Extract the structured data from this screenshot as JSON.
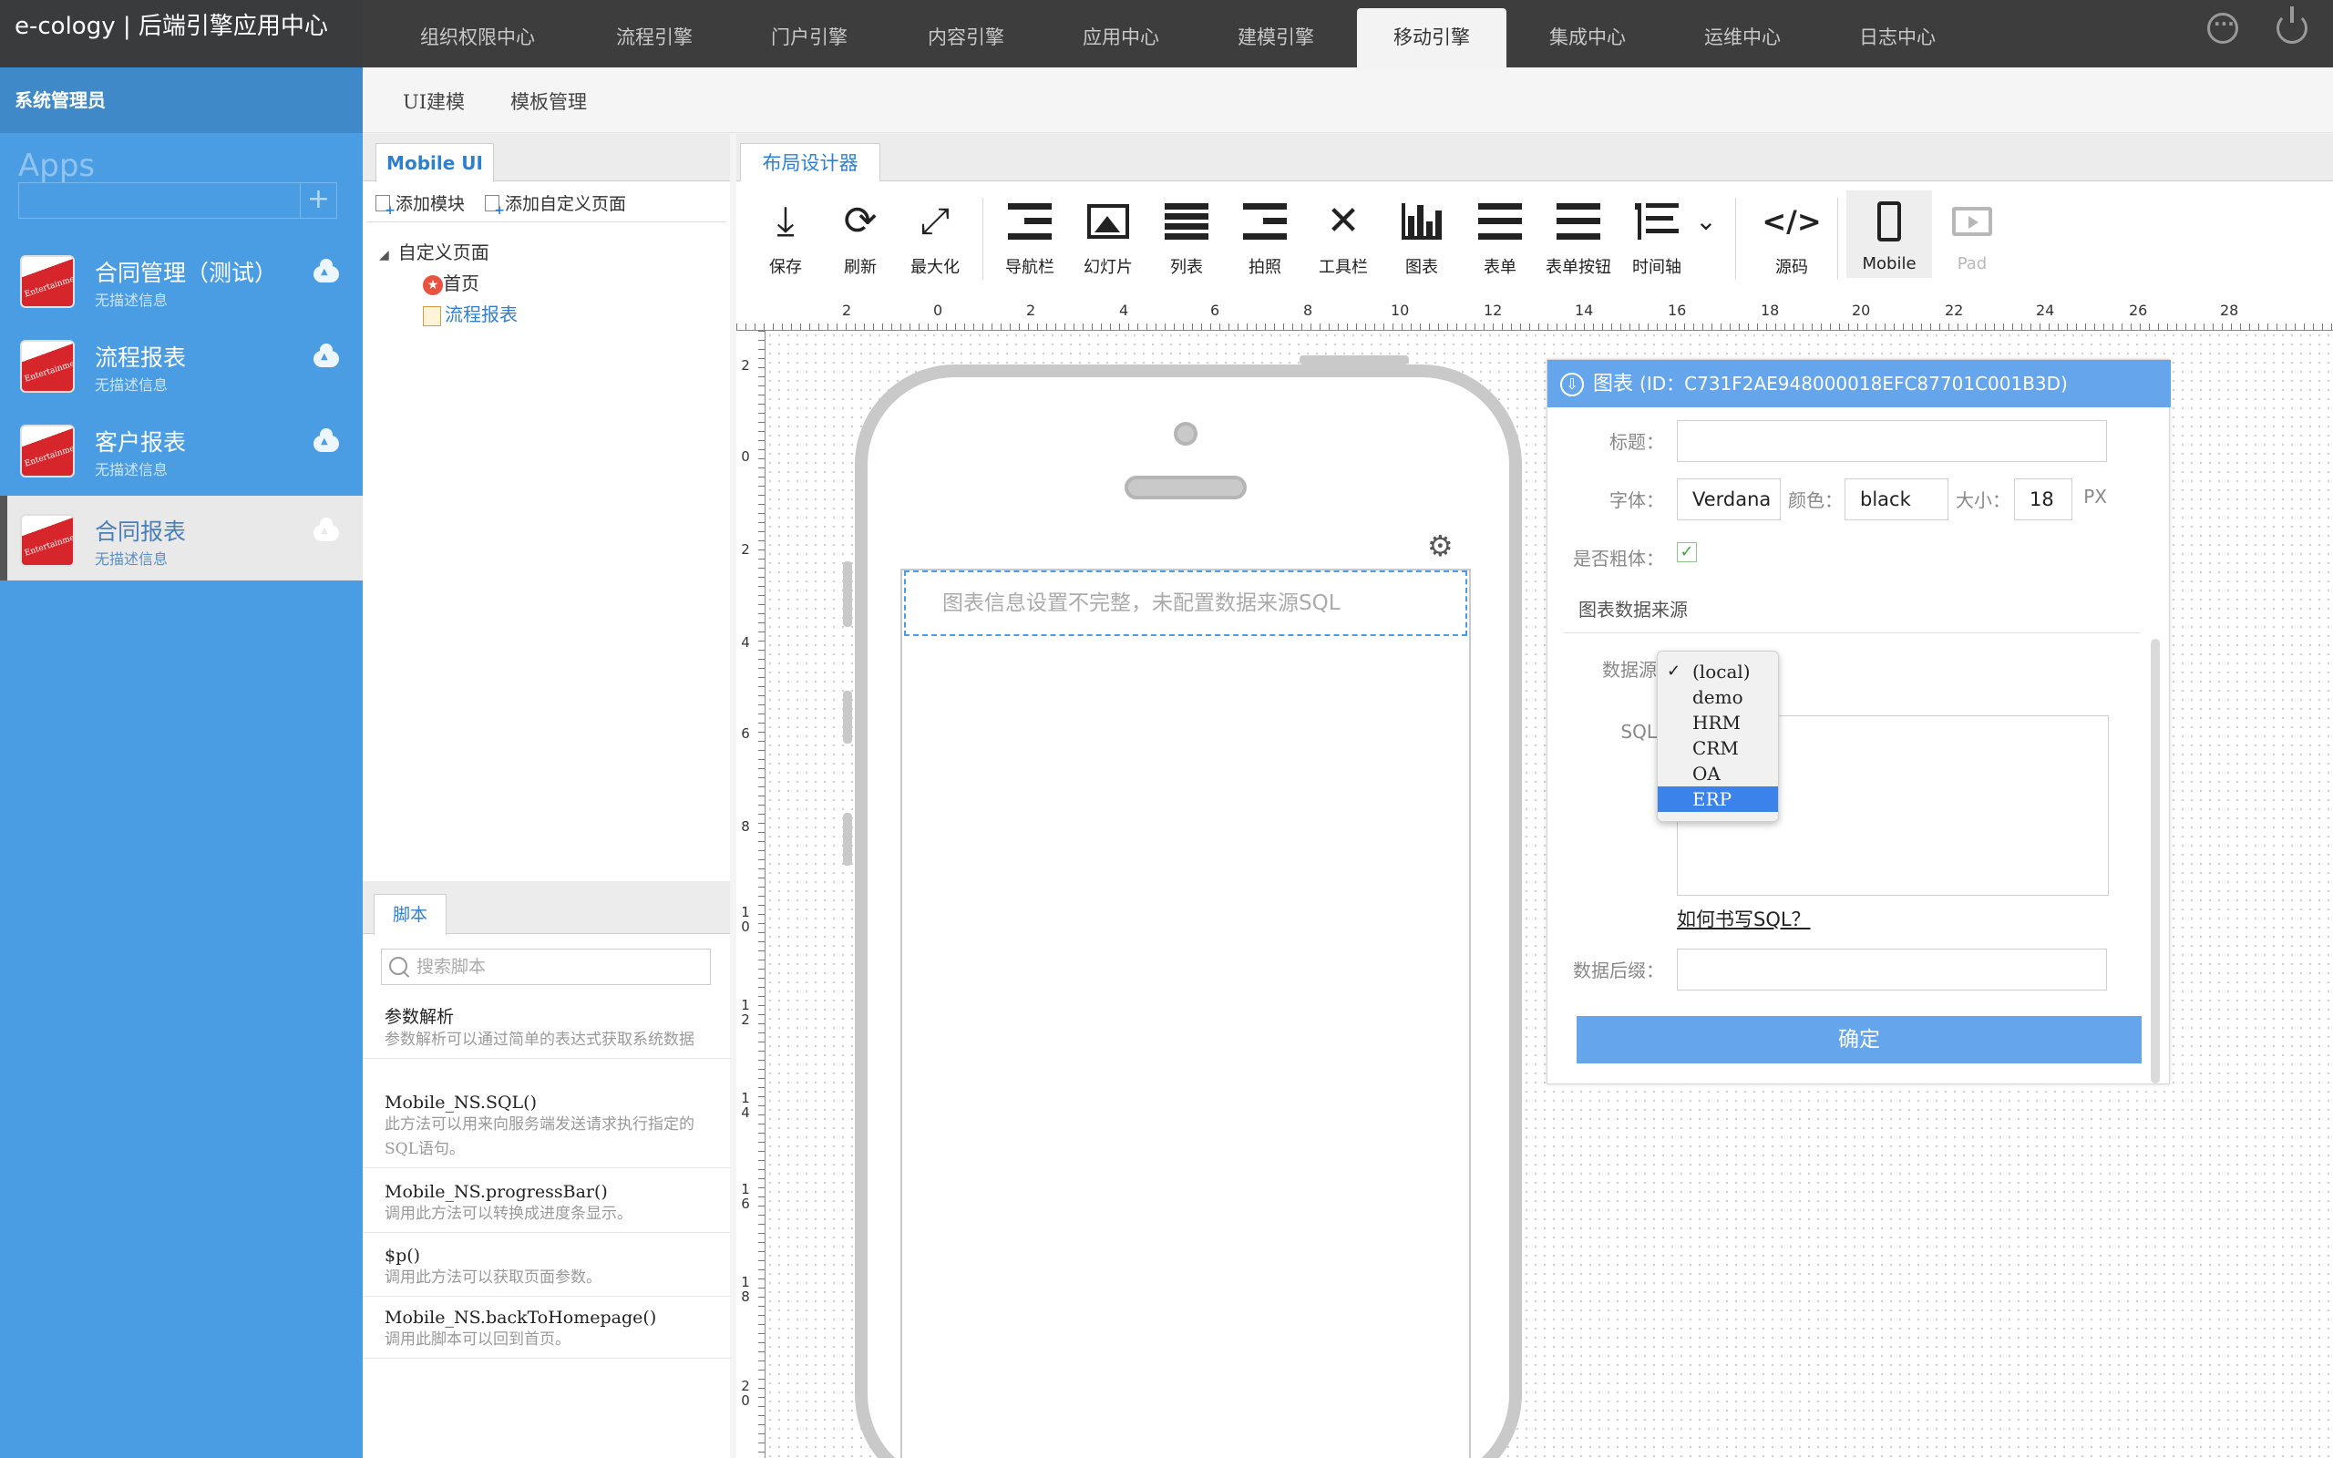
{
  "app": {
    "title": "e-cology | 后端引擎应用中心"
  },
  "nav": {
    "tabs": [
      "组织权限中心",
      "流程引擎",
      "门户引擎",
      "内容引擎",
      "应用中心",
      "建模引擎",
      "移动引擎",
      "集成中心",
      "运维中心",
      "日志中心"
    ],
    "active": "移动引擎"
  },
  "sidebar": {
    "user": "系统管理员",
    "apps_label": "Apps",
    "add_symbol": "+",
    "items": [
      {
        "title": "合同管理（测试）",
        "desc": "无描述信息"
      },
      {
        "title": "流程报表",
        "desc": "无描述信息"
      },
      {
        "title": "客户报表",
        "desc": "无描述信息"
      },
      {
        "title": "合同报表",
        "desc": "无描述信息",
        "active": true
      }
    ]
  },
  "subnav": {
    "items": [
      "UI建模",
      "模板管理"
    ]
  },
  "left_panel": {
    "tab": "Mobile UI",
    "add_module": "添加模块",
    "add_custom_page": "添加自定义页面",
    "tree": {
      "root": "自定义页面",
      "children": [
        "首页",
        "流程报表"
      ]
    },
    "script_tab": "脚本",
    "search_placeholder": "搜索脚本",
    "scripts": [
      {
        "name": "参数解析",
        "desc": "参数解析可以通过简单的表达式获取系统数据"
      },
      {
        "name": "Mobile_NS.SQL()",
        "desc": "此方法可以用来向服务端发送请求执行指定的SQL语句。"
      },
      {
        "name": "Mobile_NS.progressBar()",
        "desc": "调用此方法可以转换成进度条显示。"
      },
      {
        "name": "$p()",
        "desc": "调用此方法可以获取页面参数。"
      },
      {
        "name": "Mobile_NS.backToHomepage()",
        "desc": "调用此脚本可以回到首页。"
      }
    ]
  },
  "designer": {
    "tab": "布局设计器",
    "toolbar": [
      "保存",
      "刷新",
      "最大化",
      "导航栏",
      "幻灯片",
      "列表",
      "拍照",
      "工具栏",
      "图表",
      "表单",
      "表单按钮",
      "时间轴",
      "源码",
      "Mobile",
      "Pad"
    ],
    "ruler_top": [
      "2",
      "0",
      "2",
      "4",
      "6",
      "8",
      "10",
      "12",
      "14",
      "16",
      "18",
      "20",
      "22",
      "24",
      "26",
      "28"
    ],
    "ruler_left": [
      "2",
      "0",
      "2",
      "4",
      "6",
      "8",
      "1 0",
      "1 2",
      "1 4",
      "1 6",
      "1 8",
      "2 0"
    ],
    "placeholder": "图表信息设置不完整，未配置数据来源SQL"
  },
  "dialog": {
    "title": "图表",
    "id_text": "(ID：C731F2AE948000018EFC87701C001B3D)",
    "labels": {
      "title": "标题：",
      "font": "字体：",
      "color": "颜色：",
      "size": "大小：",
      "unit": "PX",
      "bold": "是否粗体：",
      "section": "图表数据来源",
      "datasource": "数据源",
      "sql": "SQL",
      "help": "如何书写SQL？",
      "suffix": "数据后缀："
    },
    "values": {
      "title": "",
      "font": "Verdana",
      "color": "black",
      "size": "18",
      "suffix": ""
    },
    "datasource_options": [
      "(local)",
      "demo",
      "HRM",
      "CRM",
      "OA",
      "ERP"
    ],
    "confirm": "确定"
  }
}
